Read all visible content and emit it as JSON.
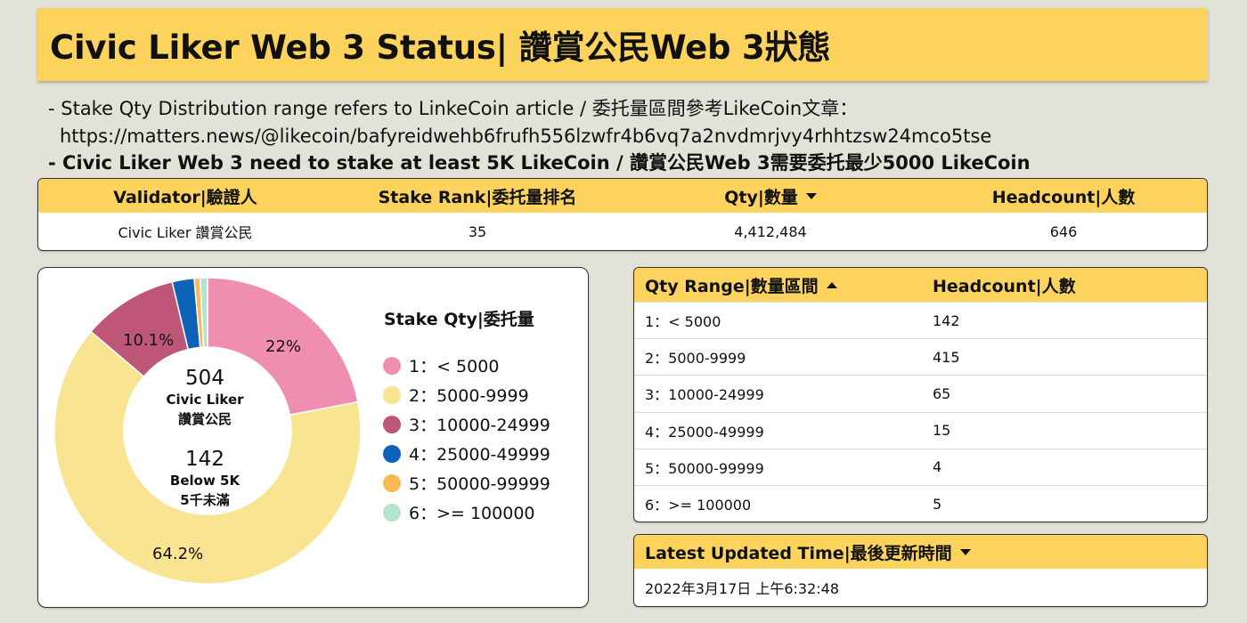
{
  "title": "Civic Liker Web 3 Status| 讚賞公民Web 3狀態",
  "notes": {
    "line1": "- Stake Qty Distribution range refers to LinkeCoin article / 委托量區間參考LikeCoin文章：",
    "line2": "https://matters.news/@likecoin/bafyreidwehb6frufh556lzwfr4b6vq7a2nvdmrjvy4rhhtzsw24mco5tse",
    "line3": "- Civic Liker Web 3 need to stake at least 5K LikeCoin / 讚賞公民Web 3需要委托最少5000 LikeCoin"
  },
  "validator_table": {
    "headers": [
      "Validator|驗證人",
      "Stake Rank|委托量排名",
      "Qty|數量",
      "Headcount|人數"
    ],
    "row": [
      "Civic Liker 讚賞公民",
      "35",
      "4,412,484",
      "646"
    ]
  },
  "chart_data": {
    "type": "pie",
    "variant": "donut",
    "legend_title": "Stake Qty|委托量",
    "categories": [
      "1：< 5000",
      "2：5000-9999",
      "3：10000-24999",
      "4：25000-49999",
      "5：50000-99999",
      "6：>= 100000"
    ],
    "values": [
      142,
      415,
      65,
      15,
      4,
      5
    ],
    "colors": [
      "#f08eb1",
      "#f8e491",
      "#be5777",
      "#0b62b6",
      "#f9b955",
      "#b3e4cd"
    ],
    "data_labels": [
      "22%",
      "64.2%",
      "10.1%",
      "",
      "",
      ""
    ],
    "center": {
      "num1": "504",
      "label1a": "Civic Liker",
      "label1b": "讚賞公民",
      "num2": "142",
      "label2a": "Below 5K",
      "label2b": "5千未滿"
    },
    "legend_position": "right"
  },
  "range_table": {
    "headers": [
      "Qty Range|數量區間",
      "Headcount|人數"
    ],
    "rows": [
      [
        "1：< 5000",
        "142"
      ],
      [
        "2：5000-9999",
        "415"
      ],
      [
        "3：10000-24999",
        "65"
      ],
      [
        "4：25000-49999",
        "15"
      ],
      [
        "5：50000-99999",
        "4"
      ],
      [
        "6：>= 100000",
        "5"
      ]
    ]
  },
  "updated": {
    "header": "Latest Updated Time|最後更新時間",
    "value": "2022年3月17日 上午6:32:48"
  },
  "icons": {
    "qty_sort": "sort-descending-icon",
    "range_sort": "sort-ascending-icon",
    "updated_sort": "sort-descending-icon"
  }
}
